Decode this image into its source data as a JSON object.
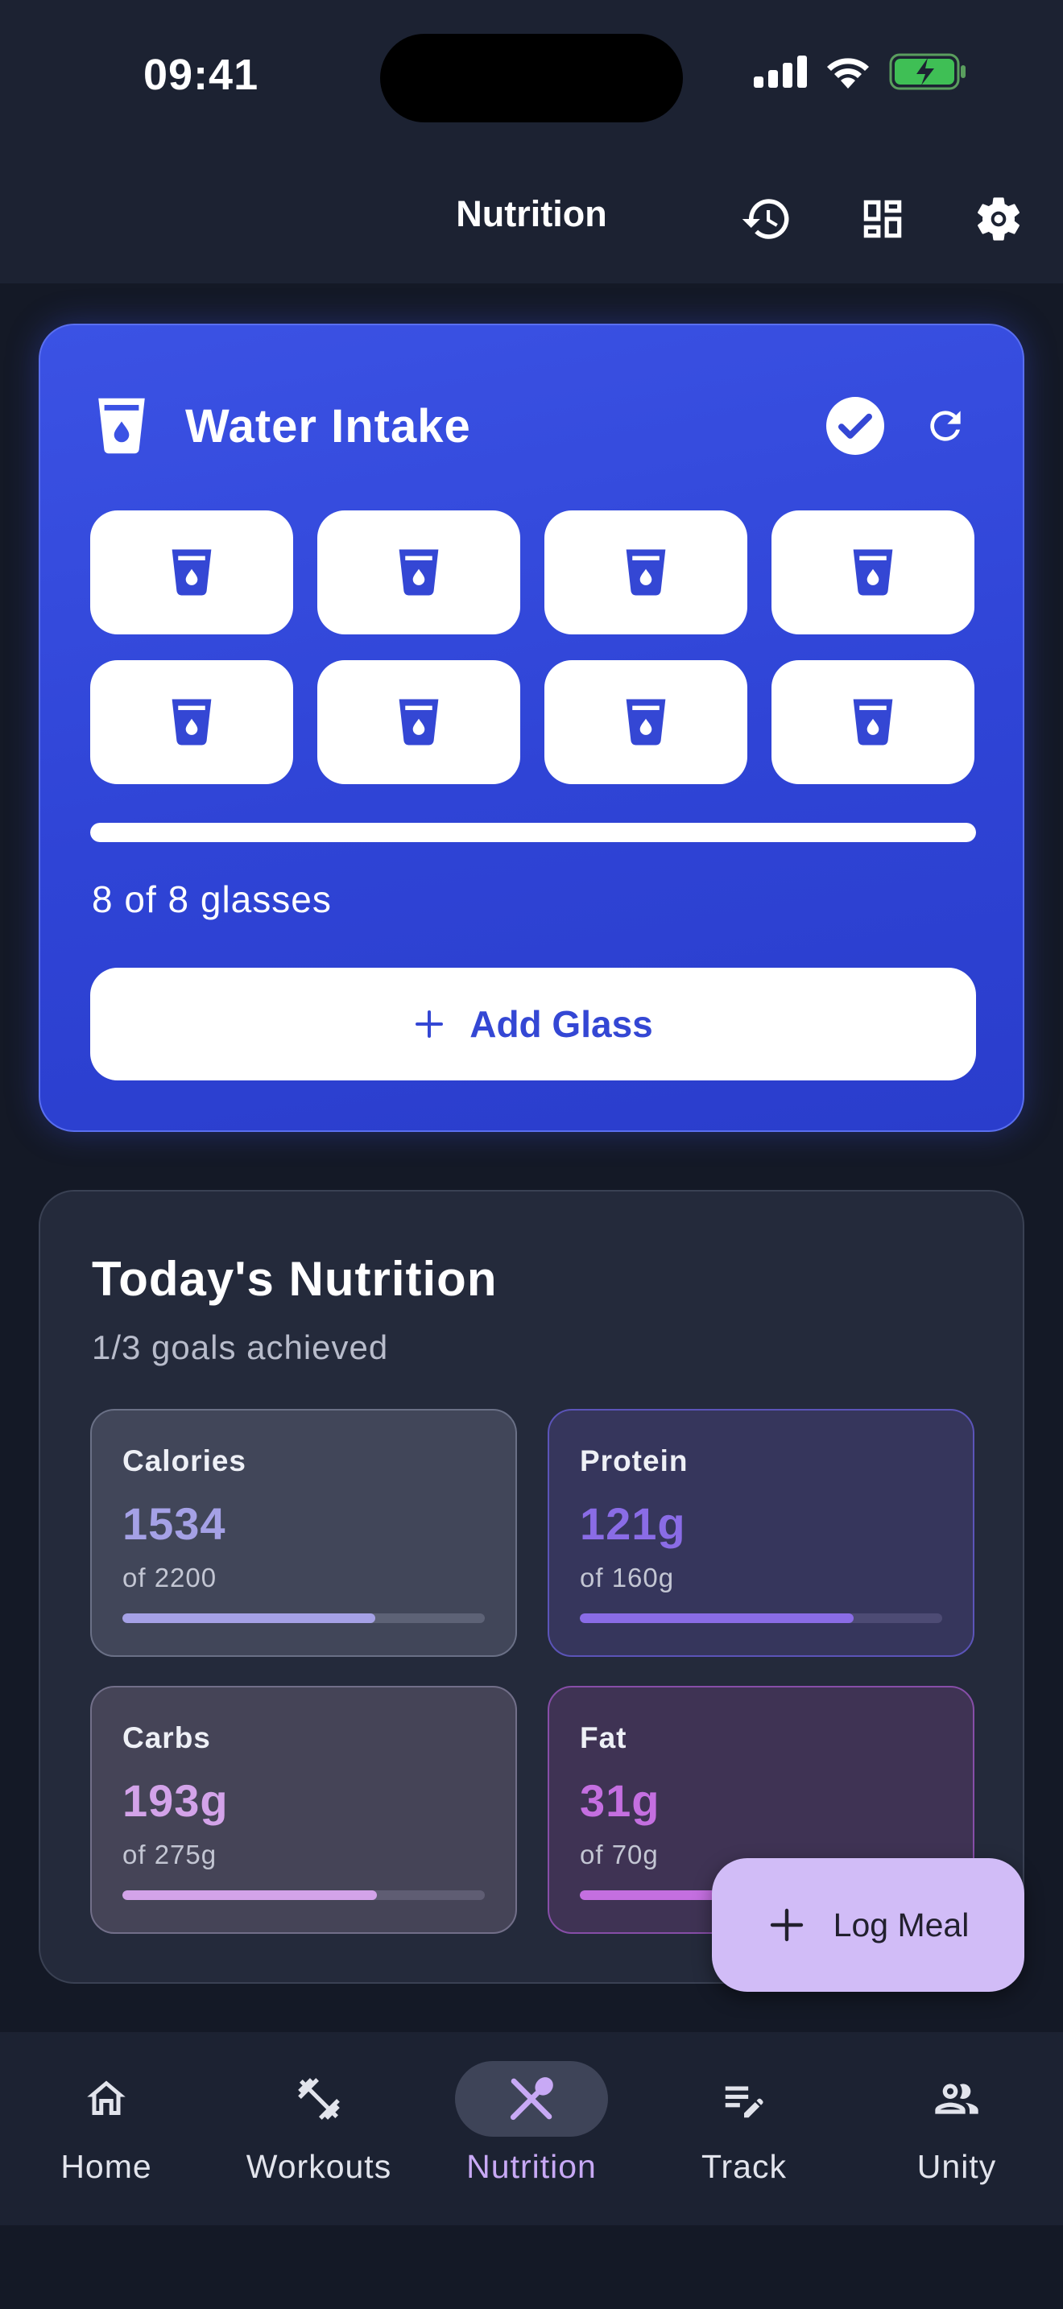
{
  "status_bar": {
    "time": "09:41"
  },
  "app_bar": {
    "title": "Nutrition",
    "actions": [
      "history-icon",
      "dashboard-icon",
      "settings-icon"
    ]
  },
  "water": {
    "title": "Water Intake",
    "glasses_filled": 8,
    "glasses_total": 8,
    "progress": 1.0,
    "count_text": "8 of 8 glasses",
    "add_label": "Add Glass",
    "accent": "#3447d4"
  },
  "nutrition": {
    "title": "Today's Nutrition",
    "subtitle": "1/3 goals achieved",
    "macros": {
      "calories": {
        "label": "Calories",
        "value": "1534",
        "goal": "of 2200",
        "progress": 0.697,
        "color": "#a5a1e6"
      },
      "protein": {
        "label": "Protein",
        "value": "121g",
        "goal": "of 160g",
        "progress": 0.756,
        "color": "#8a6ce6"
      },
      "carbs": {
        "label": "Carbs",
        "value": "193g",
        "goal": "of 275g",
        "progress": 0.702,
        "color": "#d3a3e9"
      },
      "fat": {
        "label": "Fat",
        "value": "31g",
        "goal": "of 70g",
        "progress": 0.443,
        "color": "#c46fe0"
      }
    }
  },
  "fab": {
    "label": "Log Meal"
  },
  "nav": {
    "items": [
      {
        "label": "Home",
        "icon": "home-icon"
      },
      {
        "label": "Workouts",
        "icon": "dumbbell-icon"
      },
      {
        "label": "Nutrition",
        "icon": "utensils-icon",
        "active": true
      },
      {
        "label": "Track",
        "icon": "edit-note-icon"
      },
      {
        "label": "Unity",
        "icon": "people-icon"
      }
    ]
  }
}
